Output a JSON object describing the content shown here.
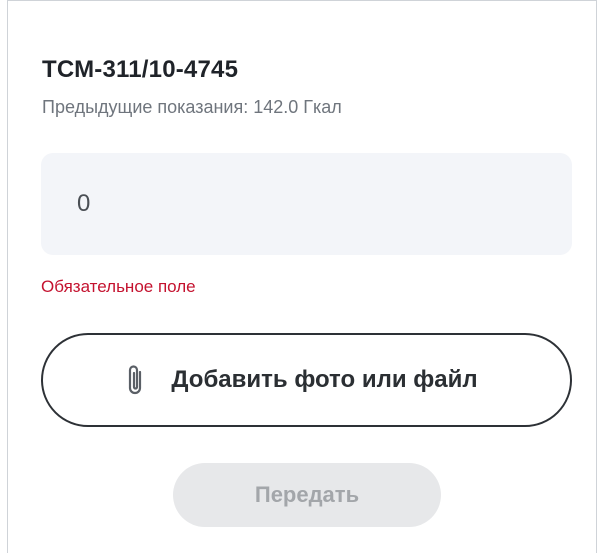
{
  "meter": {
    "title": "ТСМ-311/10-4745",
    "previous_reading": "Предыдущие показания: 142.0 Гкал"
  },
  "reading_input": {
    "value": "",
    "placeholder": "0"
  },
  "validation": {
    "error": "Обязательное поле",
    "error_color": "#c4122f"
  },
  "attach": {
    "label": "Добавить фото или файл",
    "icon": "paperclip-icon"
  },
  "submit": {
    "label": "Передать",
    "disabled": true
  }
}
